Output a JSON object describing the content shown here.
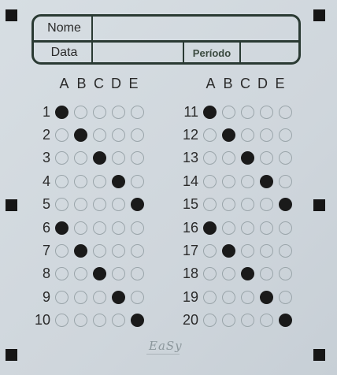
{
  "header": {
    "name_label": "Nome",
    "date_label": "Data",
    "period_label": "Período"
  },
  "columns_left": [
    "A",
    "B",
    "C",
    "D",
    "E"
  ],
  "columns_right": [
    "A",
    "B",
    "C",
    "D",
    "E"
  ],
  "left_questions": [
    {
      "num": "1",
      "filled": 0
    },
    {
      "num": "2",
      "filled": 1
    },
    {
      "num": "3",
      "filled": 2
    },
    {
      "num": "4",
      "filled": 3
    },
    {
      "num": "5",
      "filled": 4
    },
    {
      "num": "6",
      "filled": 0
    },
    {
      "num": "7",
      "filled": 1
    },
    {
      "num": "8",
      "filled": 2
    },
    {
      "num": "9",
      "filled": 3
    },
    {
      "num": "10",
      "filled": 4
    }
  ],
  "right_questions": [
    {
      "num": "11",
      "filled": 0
    },
    {
      "num": "12",
      "filled": 1
    },
    {
      "num": "13",
      "filled": 2
    },
    {
      "num": "14",
      "filled": 3
    },
    {
      "num": "15",
      "filled": 4
    },
    {
      "num": "16",
      "filled": 0
    },
    {
      "num": "17",
      "filled": 1
    },
    {
      "num": "18",
      "filled": 2
    },
    {
      "num": "19",
      "filled": 3
    },
    {
      "num": "20",
      "filled": 4
    }
  ],
  "logo_text": "EaSy",
  "colors": {
    "fill": "#1a1a1a",
    "border": "#2a3a33",
    "paper": "#d4dbe0"
  }
}
